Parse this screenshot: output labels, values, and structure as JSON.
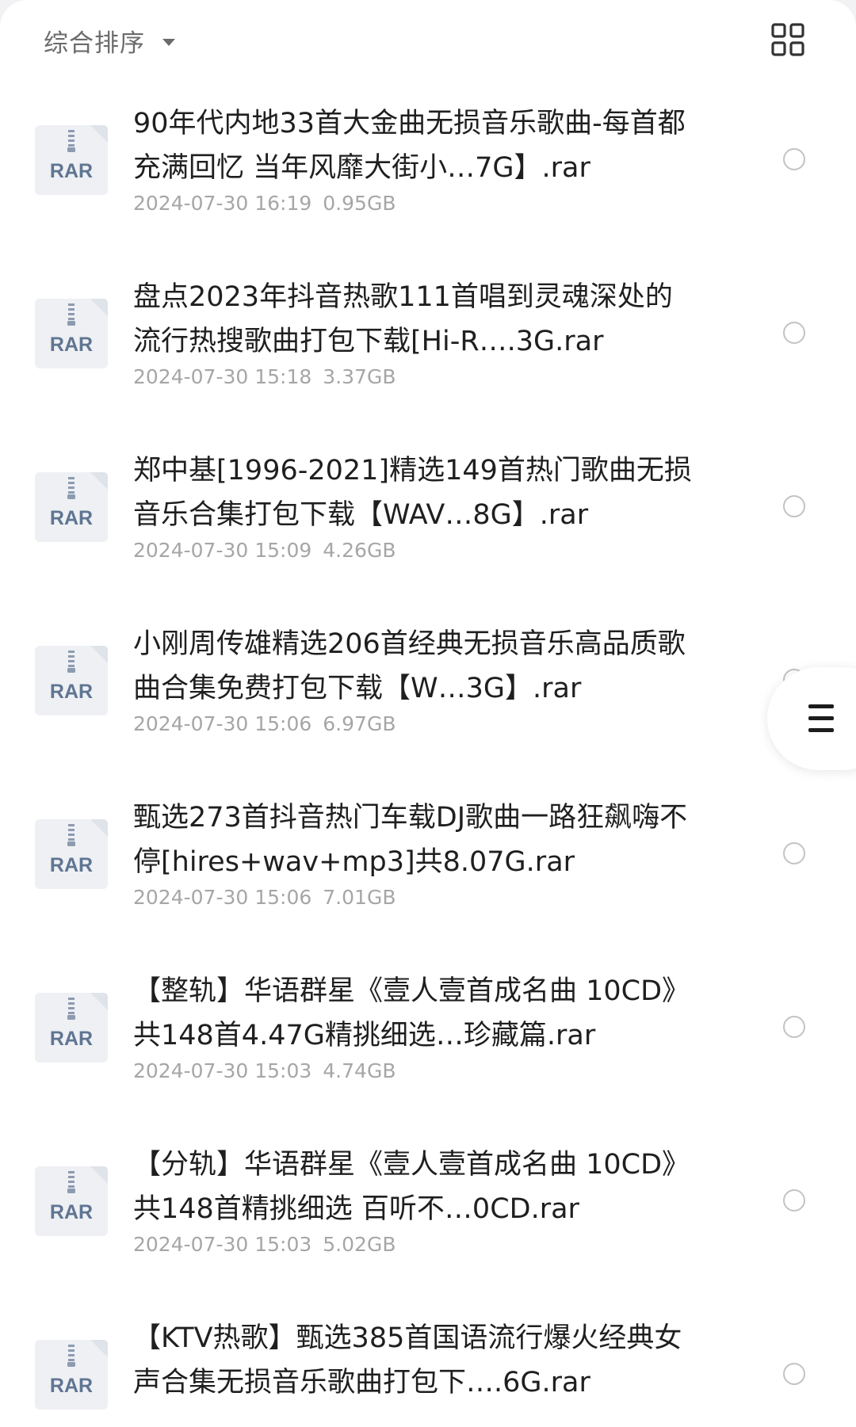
{
  "header": {
    "sort_label": "综合排序",
    "sort_icon": "chevron-down-icon",
    "view_toggle_icon": "grid-view-icon"
  },
  "file_type_badge": "RAR",
  "files": [
    {
      "name": "90年代内地33首大金曲无损音乐歌曲-每首都充满回忆 当年风靡大街小…7G】.rar",
      "date": "2024-07-30 16:19",
      "size": "0.95GB"
    },
    {
      "name": "盘点2023年抖音热歌111首唱到灵魂深处的流行热搜歌曲打包下载[Hi-R….3G.rar",
      "date": "2024-07-30 15:18",
      "size": "3.37GB"
    },
    {
      "name": "郑中基[1996-2021]精选149首热门歌曲无损音乐合集打包下载【WAV…8G】.rar",
      "date": "2024-07-30 15:09",
      "size": "4.26GB"
    },
    {
      "name": "小刚周传雄精选206首经典无损音乐高品质歌曲合集免费打包下载【W…3G】.rar",
      "date": "2024-07-30 15:06",
      "size": "6.97GB"
    },
    {
      "name": "甄选273首抖音热门车载DJ歌曲一路狂飙嗨不停[hires+wav+mp3]共8.07G.rar",
      "date": "2024-07-30 15:06",
      "size": "7.01GB"
    },
    {
      "name": "【整轨】华语群星《壹人壹首成名曲 10CD》共148首4.47G精挑细选…珍藏篇.rar",
      "date": "2024-07-30 15:03",
      "size": "4.74GB"
    },
    {
      "name": "【分轨】华语群星《壹人壹首成名曲 10CD》共148首精挑细选 百听不…0CD.rar",
      "date": "2024-07-30 15:03",
      "size": "5.02GB"
    },
    {
      "name": "【KTV热歌】甄选385首国语流行爆火经典女声合集无损音乐歌曲打包下….6G.rar",
      "date": "",
      "size": ""
    }
  ],
  "drawer_handle_icon": "menu-icon",
  "colors": {
    "title_text": "#1f1f1f",
    "meta_text": "#a6a6a6",
    "badge_text": "#5f7592",
    "badge_bg": "#eef0f4",
    "radio_border": "#c3c3c3"
  }
}
